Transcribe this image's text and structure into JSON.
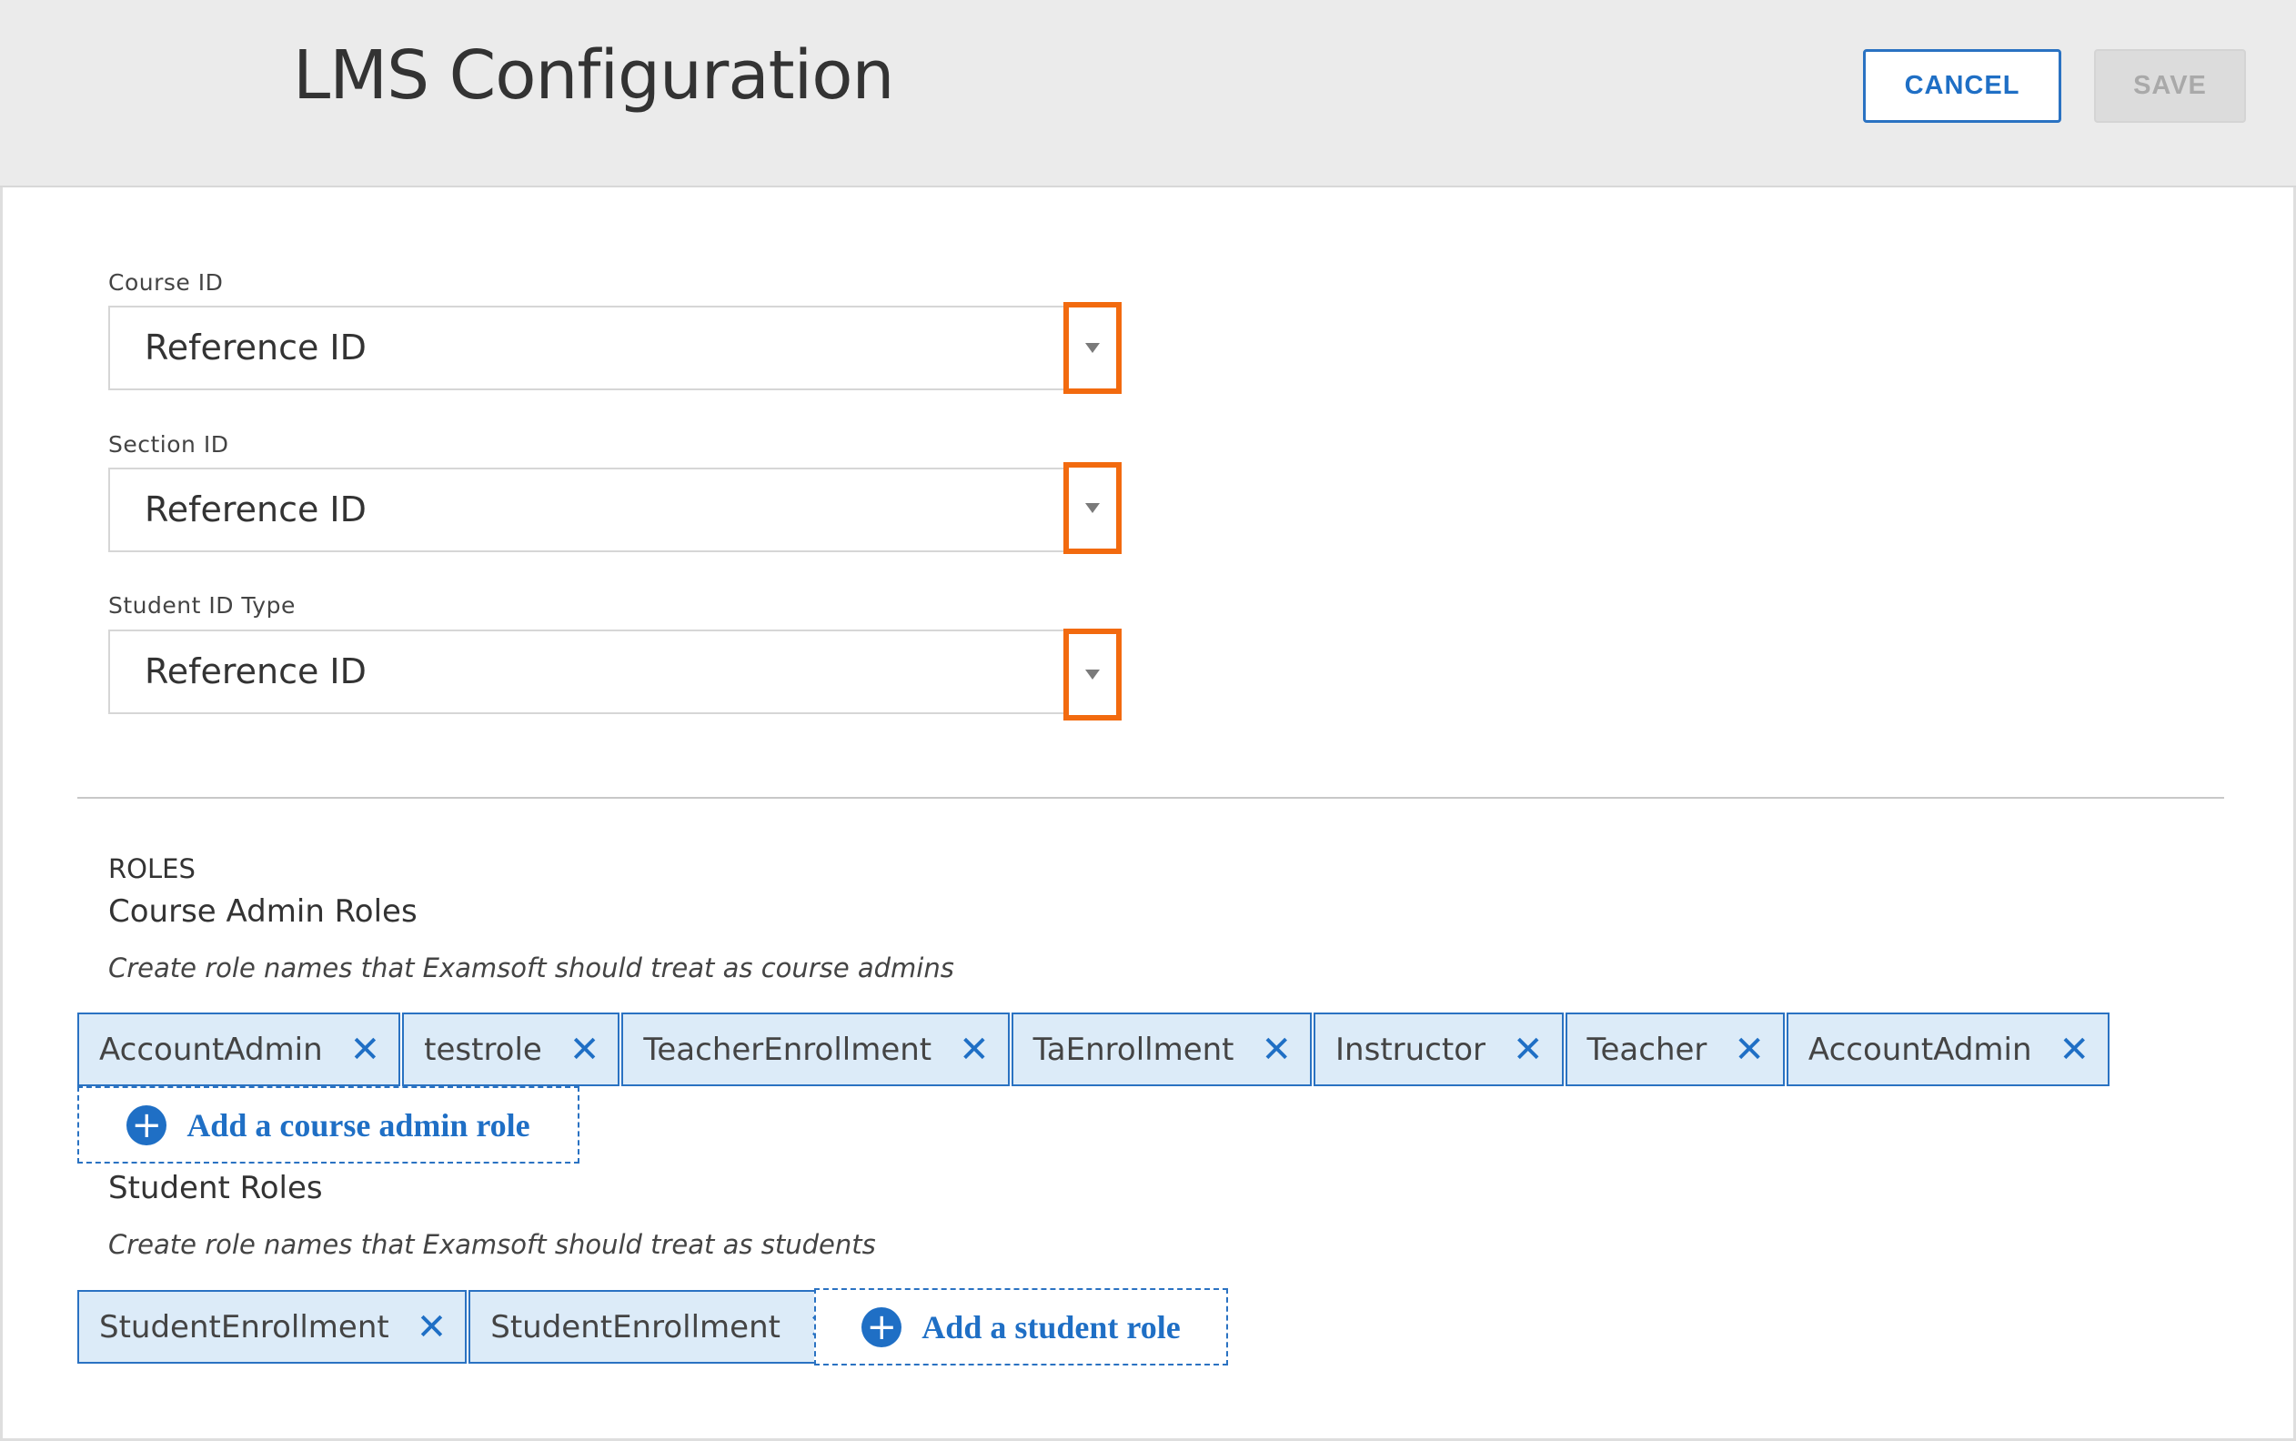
{
  "header": {
    "title": "LMS Configuration",
    "cancel_label": "CANCEL",
    "save_label": "SAVE"
  },
  "fields": [
    {
      "label": "Course ID",
      "value": "Reference ID"
    },
    {
      "label": "Section ID",
      "value": "Reference ID"
    },
    {
      "label": "Student ID Type",
      "value": "Reference ID"
    }
  ],
  "roles": {
    "heading": "ROLES",
    "course_admin": {
      "title": "Course Admin Roles",
      "description": "Create role names that Examsoft should treat as course admins",
      "tags": [
        "AccountAdmin",
        "testrole",
        "TeacherEnrollment",
        "TaEnrollment",
        "Instructor",
        "Teacher",
        "AccountAdmin"
      ],
      "add_label": "Add a course admin role"
    },
    "student": {
      "title": "Student Roles",
      "description": "Create role names that Examsoft should treat as students",
      "tags": [
        "StudentEnrollment",
        "StudentEnrollment"
      ],
      "add_label": "Add a student role"
    }
  },
  "icons": {
    "remove": "close-icon",
    "add": "plus-circle-icon",
    "dropdown": "caret-down-icon"
  },
  "colors": {
    "accent": "#1f6fc5",
    "highlight": "#f26a0f",
    "tag_bg": "#dcebf8",
    "header_bg": "#ebebeb"
  },
  "glyphs": {
    "close": "✕",
    "plus": "+"
  }
}
